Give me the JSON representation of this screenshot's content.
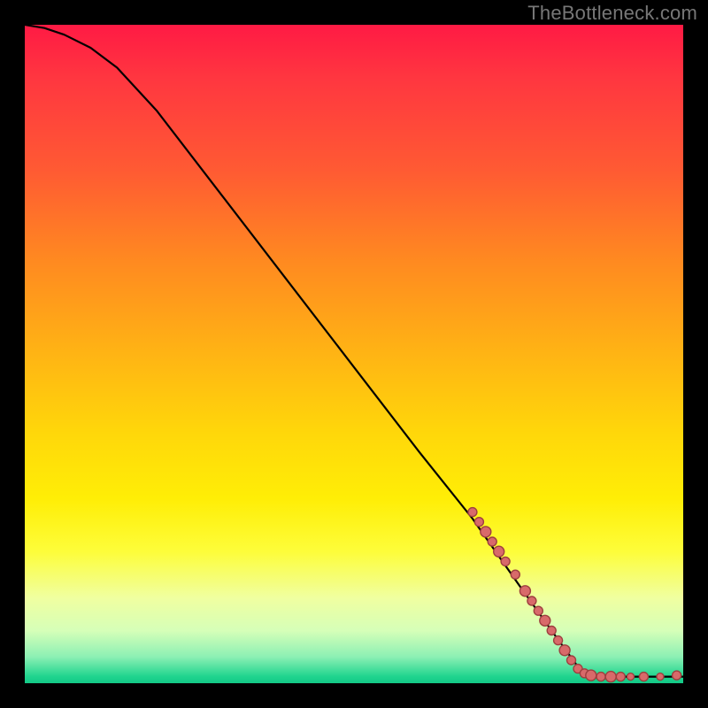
{
  "attribution": "TheBottleneck.com",
  "chart_data": {
    "type": "line",
    "title": "",
    "xlabel": "",
    "ylabel": "",
    "xlim": [
      0,
      100
    ],
    "ylim": [
      0,
      100
    ],
    "curve": [
      {
        "x": 0,
        "y": 100
      },
      {
        "x": 3,
        "y": 99.5
      },
      {
        "x": 6,
        "y": 98.5
      },
      {
        "x": 10,
        "y": 96.5
      },
      {
        "x": 14,
        "y": 93.5
      },
      {
        "x": 20,
        "y": 87
      },
      {
        "x": 30,
        "y": 74
      },
      {
        "x": 40,
        "y": 61
      },
      {
        "x": 50,
        "y": 48
      },
      {
        "x": 60,
        "y": 35
      },
      {
        "x": 68,
        "y": 25
      },
      {
        "x": 75,
        "y": 15
      },
      {
        "x": 80,
        "y": 8
      },
      {
        "x": 84,
        "y": 2.5
      },
      {
        "x": 86,
        "y": 1.2
      },
      {
        "x": 88,
        "y": 1.0
      },
      {
        "x": 92,
        "y": 1.0
      },
      {
        "x": 96,
        "y": 1.0
      },
      {
        "x": 99,
        "y": 1.0
      },
      {
        "x": 100,
        "y": 1.0
      }
    ],
    "series": [
      {
        "name": "bottleneck-points",
        "points": [
          {
            "x": 68,
            "y": 26,
            "r": 5
          },
          {
            "x": 69,
            "y": 24.5,
            "r": 5
          },
          {
            "x": 70,
            "y": 23,
            "r": 6
          },
          {
            "x": 71,
            "y": 21.5,
            "r": 5
          },
          {
            "x": 72,
            "y": 20,
            "r": 6
          },
          {
            "x": 73,
            "y": 18.5,
            "r": 5
          },
          {
            "x": 74.5,
            "y": 16.5,
            "r": 5
          },
          {
            "x": 76,
            "y": 14,
            "r": 6
          },
          {
            "x": 77,
            "y": 12.5,
            "r": 5
          },
          {
            "x": 78,
            "y": 11,
            "r": 5
          },
          {
            "x": 79,
            "y": 9.5,
            "r": 6
          },
          {
            "x": 80,
            "y": 8,
            "r": 5
          },
          {
            "x": 81,
            "y": 6.5,
            "r": 5
          },
          {
            "x": 82,
            "y": 5,
            "r": 6
          },
          {
            "x": 83,
            "y": 3.5,
            "r": 5
          },
          {
            "x": 84,
            "y": 2.2,
            "r": 5
          },
          {
            "x": 85,
            "y": 1.5,
            "r": 5
          },
          {
            "x": 86,
            "y": 1.2,
            "r": 6
          },
          {
            "x": 87.5,
            "y": 1.0,
            "r": 5
          },
          {
            "x": 89,
            "y": 1.0,
            "r": 6
          },
          {
            "x": 90.5,
            "y": 1.0,
            "r": 5
          },
          {
            "x": 92,
            "y": 1.0,
            "r": 4
          },
          {
            "x": 94,
            "y": 1.0,
            "r": 5
          },
          {
            "x": 96.5,
            "y": 1.0,
            "r": 4
          },
          {
            "x": 99,
            "y": 1.2,
            "r": 5
          }
        ]
      }
    ],
    "colors": {
      "curve": "#000000",
      "marker_fill": "#d86a6a",
      "marker_stroke": "#9e3f3f"
    }
  }
}
